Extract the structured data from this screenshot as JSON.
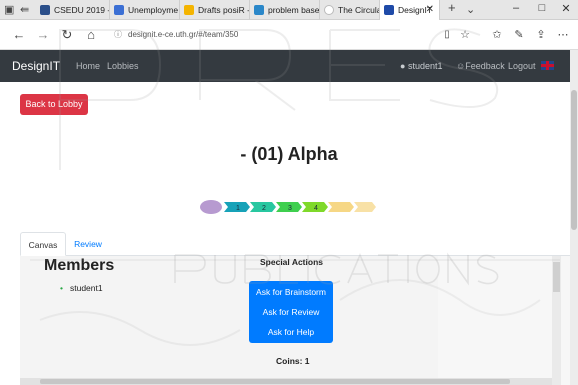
{
  "browser": {
    "tabs": [
      {
        "title": "CSEDU 2019 -",
        "color": "#2b4f8a"
      },
      {
        "title": "Unemployme",
        "color": "#3b6fd4"
      },
      {
        "title": "Drafts posiR -",
        "color": "#f4b400"
      },
      {
        "title": "problem base",
        "color": "#2a87c9"
      },
      {
        "title": "The Circular C",
        "color": "#bbbbbb"
      },
      {
        "title": "DesignIT",
        "color": "#1f4aa8"
      }
    ],
    "url": "designit.e-ce.uth.gr/#/team/350",
    "icons": [
      "back-icon",
      "forward-icon",
      "refresh-icon",
      "home-icon",
      "star-icon",
      "favorites-icon",
      "pen-icon",
      "share-icon",
      "more-icon",
      "minimize-icon",
      "maximize-icon",
      "close-icon"
    ]
  },
  "navbar": {
    "brand": "DesignIT",
    "home": "Home",
    "lobbies": "Lobbies",
    "user": "student1",
    "feedback": "Feedback",
    "logout": "Logout",
    "flag_colors": {
      "blue": "#21468b",
      "red": "#c8102e"
    }
  },
  "page": {
    "back_button": "Back to Lobby",
    "title": "- (01) Alpha",
    "progress": {
      "steps": [
        "",
        "1",
        "2",
        "3",
        "4",
        "",
        ""
      ],
      "colors": [
        "#b79ad0",
        "#17a2b8",
        "#28c7a0",
        "#3fcf4f",
        "#7fd92a",
        "#f3c95c",
        "#f3c95c"
      ]
    },
    "tabs": [
      "Canvas",
      "Review"
    ],
    "members_header": "Members",
    "members": [
      "student1"
    ],
    "special_header": "Special Actions",
    "actions": [
      "Ask for Brainstorm",
      "Ask for Review",
      "Ask for Help"
    ],
    "coins": "Coins: 1",
    "accent": "#007bff",
    "danger": "#dc3545"
  }
}
